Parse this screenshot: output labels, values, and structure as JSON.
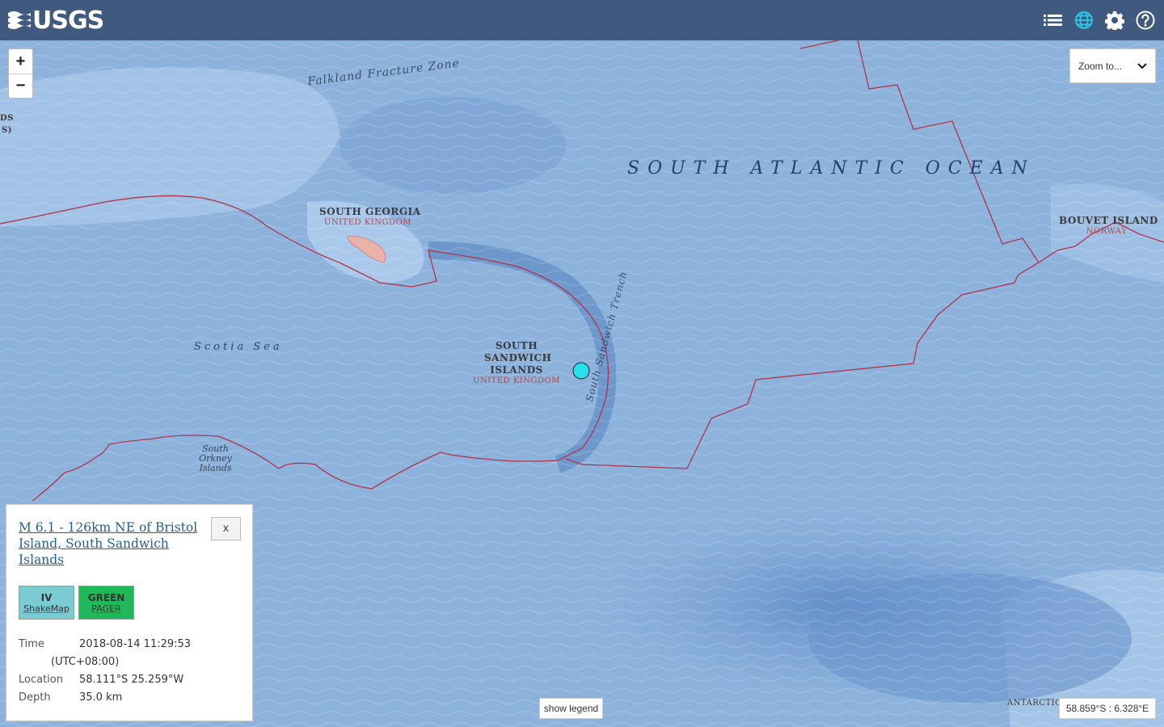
{
  "header": {
    "logo_text": "USGS",
    "icons": [
      "list-icon",
      "globe-icon",
      "gear-icon",
      "help-icon"
    ]
  },
  "map": {
    "labels": {
      "ocean": "SOUTH ATLANTIC OCEAN",
      "sea": "Scotia Sea",
      "fracture_zone": "Falkland Fracture Zone",
      "trench": "South Sandwich Trench",
      "south_georgia": "SOUTH GEORGIA",
      "south_georgia_country": "UNITED KINGDOM",
      "south_sandwich": "SOUTH SANDWICH ISLANDS",
      "south_sandwich_country": "UNITED KINGDOM",
      "south_orkney": "South Orkney Islands",
      "bouvet": "BOUVET ISLAND",
      "bouvet_country": "NORWAY",
      "falklands_partial_1": "DS",
      "falklands_partial_2": "S)",
      "antarctica_partial": "ANTARCTIC"
    },
    "colors": {
      "ocean_deep": "#6f9bd0",
      "ocean_mid": "#8fb4dd",
      "ocean_shallow": "#a8c8ea",
      "plate_boundary": "#b2334a",
      "epicenter": "#27e1e8"
    }
  },
  "controls": {
    "zoom_in": "+",
    "zoom_out": "−",
    "zoom_to": "Zoom to...",
    "show_legend": "show legend",
    "coordinates": "58.859°S : 6.328°E"
  },
  "event": {
    "title": "M 6.1 - 126km NE of Bristol Island, South Sandwich Islands",
    "close": "x",
    "shakemap": {
      "value": "IV",
      "label": "ShakeMap",
      "color": "#7bcbd3"
    },
    "pager": {
      "value": "GREEN",
      "label": "PAGER",
      "color": "#1fb85a"
    },
    "time_label": "Time",
    "time_value": "2018-08-14 11:29:53",
    "timezone": "(UTC+08:00)",
    "location_label": "Location",
    "location_value": "58.111°S 25.259°W",
    "depth_label": "Depth",
    "depth_value": "35.0 km"
  }
}
